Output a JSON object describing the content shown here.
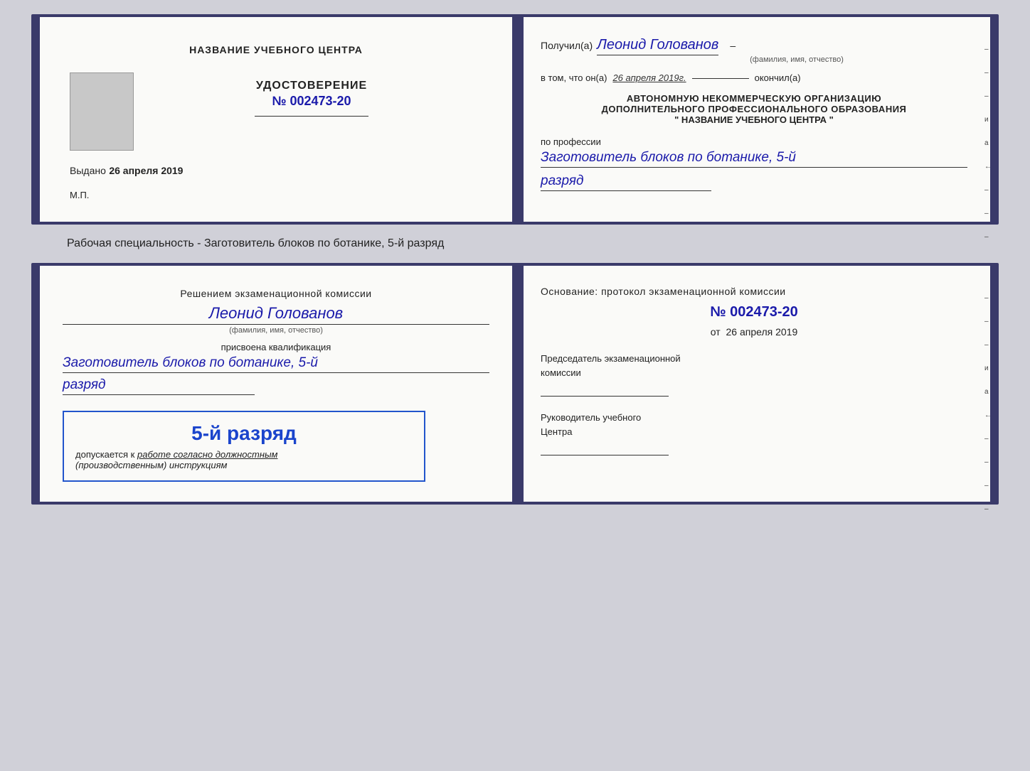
{
  "top_card": {
    "left": {
      "institution_name": "НАЗВАНИЕ УЧЕБНОГО ЦЕНТРА",
      "cert_title": "УДОСТОВЕРЕНИЕ",
      "cert_number": "№ 002473-20",
      "issued_label": "Выдано",
      "issued_date": "26 апреля 2019",
      "mp_label": "М.П."
    },
    "right": {
      "received_label": "Получил(а)",
      "recipient_name": "Леонид Голованов",
      "fio_label": "(фамилия, имя, отчество)",
      "certified_text": "в том, что он(а)",
      "certified_date": "26 апреля 2019г.",
      "certified_end": "окончил(а)",
      "org_line1": "АВТОНОМНУЮ НЕКОММЕРЧЕСКУЮ ОРГАНИЗАЦИЮ",
      "org_line2": "ДОПОЛНИТЕЛЬНОГО ПРОФЕССИОНАЛЬНОГО ОБРАЗОВАНИЯ",
      "org_line3": "\"  НАЗВАНИЕ УЧЕБНОГО ЦЕНТРА  \"",
      "profession_label": "по профессии",
      "profession_value": "Заготовитель блоков по ботанике, 5-й",
      "rank_value": "разряд"
    }
  },
  "specialty_label": "Рабочая специальность - Заготовитель блоков по ботанике, 5-й разряд",
  "bottom_card": {
    "left": {
      "commission_line1": "Решением экзаменационной комиссии",
      "person_name": "Леонид Голованов",
      "fio_label": "(фамилия, имя, отчество)",
      "qualification_label": "присвоена квалификация",
      "qualification_value": "Заготовитель блоков по ботанике, 5-й",
      "rank_value": "разряд",
      "stamp_rank": "5-й разряд",
      "stamp_allowed_prefix": "допускается к",
      "stamp_allowed_value": "работе согласно должностным",
      "stamp_allowed_cont": "(производственным) инструкциям"
    },
    "right": {
      "basis_title": "Основание: протокол экзаменационной комиссии",
      "protocol_number": "№ 002473-20",
      "protocol_date_prefix": "от",
      "protocol_date": "26 апреля 2019",
      "chairman_label": "Председатель экзаменационной",
      "chairman_label2": "комиссии",
      "director_label": "Руководитель учебного",
      "director_label2": "Центра"
    }
  },
  "right_margin": {
    "marks": [
      "-",
      "-",
      "-",
      "и",
      "а",
      "←",
      "-",
      "-",
      "-",
      "-"
    ]
  }
}
